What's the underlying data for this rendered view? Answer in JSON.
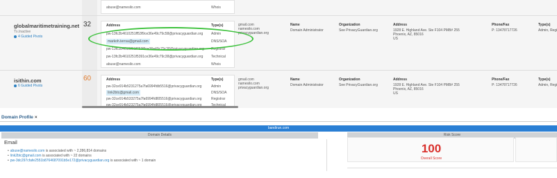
{
  "top_row": {
    "email": "abuse@namesilo.com",
    "type": "Whois"
  },
  "rows": [
    {
      "domain": "globalmaritimetraining.net",
      "meta": "Tx.Inactive",
      "pivots_label": "4 Guided Pivots",
      "count": "32",
      "count_color": "#333333",
      "headers": {
        "address": "Address",
        "type": "Type(s)"
      },
      "emails": [
        {
          "address": "pw-13fc2b4610251ff53f9ce36e49c79c58@privacyguardian.org",
          "type": "Admin"
        },
        {
          "address": "markoh.terrsa@gmail.com",
          "type": "DNS/SOA"
        },
        {
          "address": "pw-13fc2b4610251f753f9ce36e49c79c38@privacyguardian.org",
          "type": "Registrar"
        },
        {
          "address": "pw-13fc2b4610251f5391ce36e49c79c38@privacyguardian.org",
          "type": "Technical"
        },
        {
          "address": "abuse@namesilo.com",
          "type": "Whois"
        }
      ],
      "email_col": [
        "gmail.com",
        "namesilo.com",
        "privacyguardian.org"
      ],
      "whois": {
        "name_h": "Name",
        "org_h": "Organization",
        "addr_h": "Address",
        "phone_h": "Phone/Fax",
        "type_h": "Type(s)",
        "name": "Domain Administrator",
        "org": "See PrivacyGuardian.org",
        "addr": [
          "1928 E. Highland Ave. Ste F104 PMB# 255",
          "Phoenix, AZ, 85016",
          "US"
        ],
        "phone": "P: 13478717726",
        "type": "Admin, Registrar"
      }
    },
    {
      "domain": "isithin.com",
      "meta": "",
      "pivots_label": "6 Guided Pivots",
      "count": "60",
      "count_color": "#e07a2b",
      "headers": {
        "address": "Address",
        "type": "Type(s)"
      },
      "emails": [
        {
          "address": "pw-32ce914b5231275a7fa6994fdb5516@privacyguardian.org",
          "type": "Admin"
        },
        {
          "address": "Iink2btc@gmail.com",
          "type": "DNS/SOA"
        },
        {
          "address": "pw-32ce914b533275a7fa6994fd805516@privacyguardian.org",
          "type": "Registrar"
        },
        {
          "address": "pw-32ce914b523275a7fa6994fd805516@privacyguardian.org",
          "type": "Technical"
        }
      ],
      "email_col": [
        "gmail.com",
        "namesilo.com",
        "privacyguardian.org"
      ],
      "whois": {
        "name_h": "Name",
        "org_h": "Organization",
        "addr_h": "Address",
        "phone_h": "Phone/Fax",
        "type_h": "Type(s)",
        "name": "Domain Administrator",
        "org": "See PrivacyGuardian.org",
        "addr": [
          "1928 E. Highland Ave. Ste F104 PMB# 255",
          "Phoenix, AZ, 85016",
          "US"
        ],
        "phone": "P: 13478717726",
        "type": "Admin, Registrar"
      }
    }
  ],
  "profile": {
    "tab_label": "Domain Profile",
    "close_glyph": "×",
    "site": "bandirun.com",
    "left_header": "Domain Details",
    "right_header": "Risk Score",
    "email_title": "Email",
    "emails": [
      {
        "link": "abuse@namesilo.com",
        "text": " is associated with ~ 2,286,814 domains"
      },
      {
        "link": "link2btc@gmail.com",
        "text": " is associated with ~ 22 domains"
      },
      {
        "link": "pw-3dc297cfafe2551b8764687091b5e172@privacyguardian.org",
        "text": " is associated with ~ 1 domain"
      }
    ],
    "risk_score": "100",
    "risk_label": "Overall Score",
    "colors": {
      "accent": "#2a7fd4",
      "risk": "#d9302c",
      "highlight_ellipse": "#3cc13b"
    }
  }
}
